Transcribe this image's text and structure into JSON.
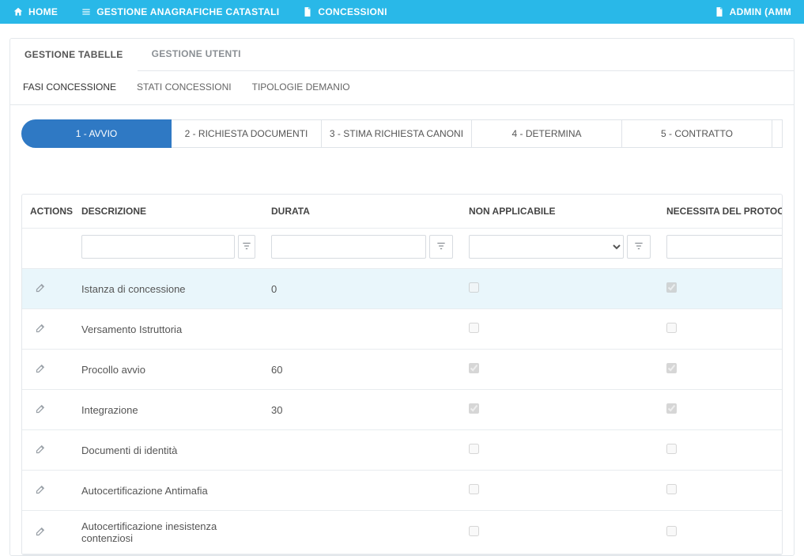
{
  "topbar": {
    "home": "HOME",
    "nav1": "GESTIONE  ANAGRAFICHE  CATASTALI",
    "nav2": "CONCESSIONI",
    "user": "ADMIN  (AMM"
  },
  "tabs_primary": {
    "t1": "GESTIONE TABELLE",
    "t2": "GESTIONE UTENTI"
  },
  "tabs_secondary": {
    "s1": "FASI CONCESSIONE",
    "s2": "STATI CONCESSIONI",
    "s3": "TIPOLOGIE DEMANIO"
  },
  "phases": {
    "p1": "1 - AVVIO",
    "p2": "2 - RICHIESTA DOCUMENTI",
    "p3": "3 - STIMA RICHIESTA CANONI",
    "p4": "4 - DETERMINA",
    "p5": "5 - CONTRATTO"
  },
  "columns": {
    "actions": "ACTIONS",
    "descrizione": "DESCRIZIONE",
    "durata": "DURATA",
    "non_applicabile": "NON APPLICABILE",
    "protocollo": "NECESSITA DEL PROTOCOLLO"
  },
  "filters": {
    "descrizione_value": "",
    "durata_value": "",
    "non_applicabile_value": "",
    "protocollo_value": ""
  },
  "rows": [
    {
      "descrizione": "Istanza di concessione",
      "durata": "0",
      "non_applicabile": false,
      "protocollo": true
    },
    {
      "descrizione": "Versamento Istruttoria",
      "durata": "",
      "non_applicabile": false,
      "protocollo": false
    },
    {
      "descrizione": "Procollo avvio",
      "durata": "60",
      "non_applicabile": true,
      "protocollo": true
    },
    {
      "descrizione": "Integrazione",
      "durata": "30",
      "non_applicabile": true,
      "protocollo": true
    },
    {
      "descrizione": "Documenti di identità",
      "durata": "",
      "non_applicabile": false,
      "protocollo": false
    },
    {
      "descrizione": "Autocertificazione Antimafia",
      "durata": "",
      "non_applicabile": false,
      "protocollo": false
    },
    {
      "descrizione": "Autocertificazione inesistenza contenziosi",
      "durata": "",
      "non_applicabile": false,
      "protocollo": false
    }
  ]
}
